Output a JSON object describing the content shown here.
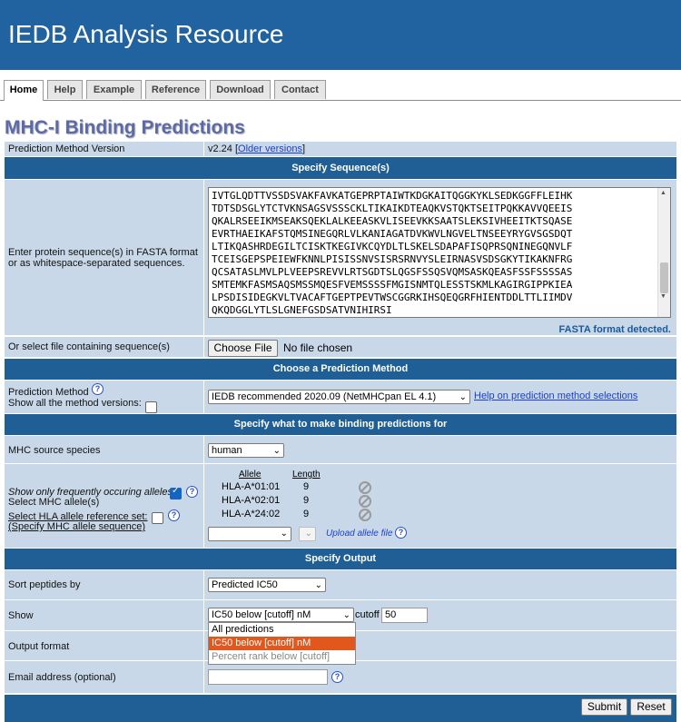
{
  "header": {
    "title": "IEDB Analysis Resource"
  },
  "tabs": [
    "Home",
    "Help",
    "Example",
    "Reference",
    "Download",
    "Contact"
  ],
  "page_title": "MHC-I Binding Predictions",
  "version_row": {
    "label": "Prediction Method Version",
    "version": "v2.24",
    "older_link": "Older versions",
    "open": "[",
    "close": "]"
  },
  "sections": {
    "sequence": "Specify Sequence(s)",
    "method": "Choose a Prediction Method",
    "binding": "Specify what to make binding predictions for",
    "output": "Specify Output"
  },
  "sequence": {
    "label_line1": "Enter protein sequence(s) in FASTA format",
    "label_line2": "or as whitespace-separated sequences.",
    "lines": [
      "IVTGLQDTTVSSDSVAKFAVKATGEPRPTAIWTKDGKAITQGGKYKLSEDKGGFFLEIHK",
      "TDTSDSGLYTCTVKNSAGSVSSSCKLTIKAIKDTEAQKVSTQKTSEITPQKKAVVQEEIS",
      "QKALRSEEIKMSEAKSQEKLALKEEASKVLISEEVKKSAATSLEKSIVHEEITKTSQASE",
      "EVRTHAEIKAFSTQMSINEGQRLVLKANIAGATDVKWVLNGVELTNSEEYRYGVSGSDQT",
      "LTIKQASHRDEGILTCISKTKEGIVKCQYDLTLSKELSDAPAFISQPRSQNINEGQNVLF",
      "TCEISGEPSPEIEWFKNNLPISISSNVSISRSRNVYSLEIRNASVSDSGKYTIKAKNFRG",
      "QCSATASLMVLPLVEEPSREVVLRTSGDTSLQGSFSSQSVQMSASKQEASFSSFSSSSAS",
      "SMTEMKFASMSAQSMSSMQESFVEMSSSSFMGISNMTQLESSTSKMLKAGIRGIPPKIEA",
      "LPSDISIDEGKVLTVACAFTGEPTPEVTWSCGGRKIHSQEQGRFHIENTDDLTTLIIMDV",
      "QKQDGGLYTLSLGNEFGSDSATVNIHIRSI"
    ],
    "fasta_status": "FASTA format detected."
  },
  "file": {
    "label": "Or select file containing sequence(s)",
    "button": "Choose File",
    "status": "No file chosen"
  },
  "method": {
    "label": "Prediction Method",
    "show_all_label": "Show all the method versions:",
    "selected": "IEDB recommended 2020.09 (NetMHCpan EL 4.1)",
    "help_link": "Help on prediction method selections"
  },
  "species": {
    "label": "MHC source species",
    "selected": "human"
  },
  "alleles": {
    "freq_label": "Show only frequently occuring alleles:",
    "select_label": "Select MHC allele(s)",
    "ref_link": "Select HLA allele reference set:",
    "specify_link": "(Specify MHC allele sequence)",
    "col_allele": "Allele",
    "col_length": "Length",
    "rows": [
      {
        "allele": "HLA-A*01:01",
        "length": "9"
      },
      {
        "allele": "HLA-A*02:01",
        "length": "9"
      },
      {
        "allele": "HLA-A*24:02",
        "length": "9"
      }
    ],
    "upload_link": "Upload allele file"
  },
  "output": {
    "sort_label": "Sort peptides by",
    "sort_selected": "Predicted IC50",
    "show_label": "Show",
    "show_selected": "IC50 below [cutoff] nM",
    "cutoff_label": "cutoff",
    "cutoff_value": "50",
    "show_options": [
      "All predictions",
      "IC50 below [cutoff] nM",
      "Percent rank below [cutoff]"
    ],
    "format_label": "Output format",
    "email_label": "Email address (optional)"
  },
  "buttons": {
    "submit": "Submit",
    "reset": "Reset"
  },
  "colors": {
    "banner": "#2162a0",
    "section": "#1f5f96",
    "row": "#c9d8e8",
    "highlight": "#e2571e"
  }
}
